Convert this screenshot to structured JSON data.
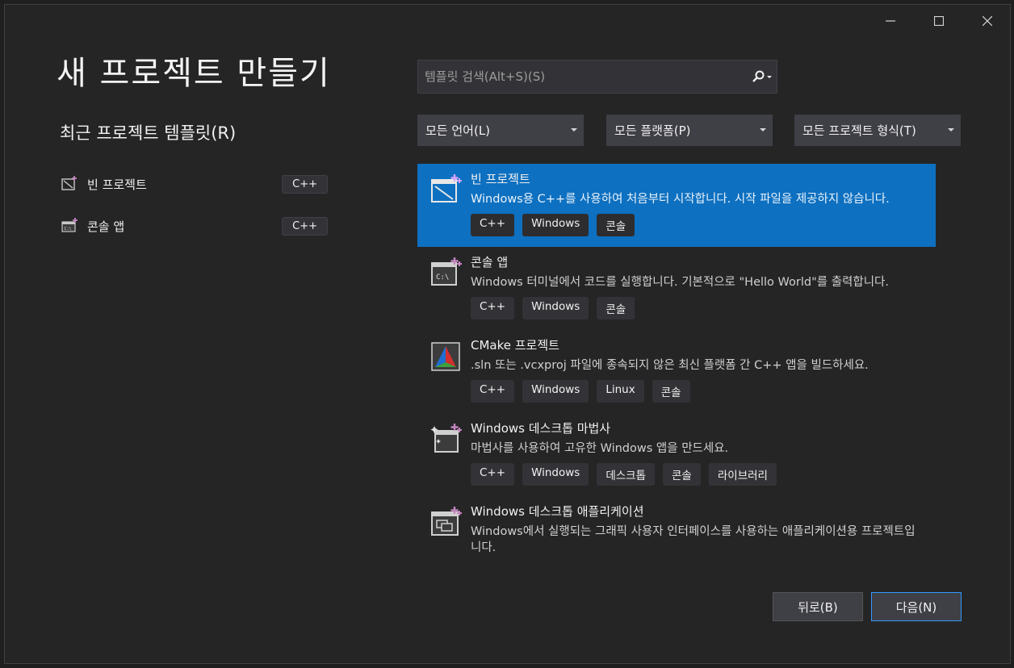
{
  "window_controls": {
    "minimize": "minimize",
    "maximize": "maximize",
    "close": "close"
  },
  "title": "새 프로젝트 만들기",
  "recent": {
    "title": "최근 프로젝트 템플릿(R)",
    "items": [
      {
        "label": "빈 프로젝트",
        "tag": "C++",
        "icon": "empty-project-icon"
      },
      {
        "label": "콘솔 앱",
        "tag": "C++",
        "icon": "console-app-icon"
      }
    ]
  },
  "search": {
    "placeholder": "템플릿 검색(Alt+S)(S)",
    "value": ""
  },
  "filters": [
    {
      "label": "모든 언어(L)"
    },
    {
      "label": "모든 플랫폼(P)"
    },
    {
      "label": "모든 프로젝트 형식(T)"
    }
  ],
  "templates": [
    {
      "name": "빈 프로젝트",
      "description": "Windows용 C++를 사용하여 처음부터 시작합니다. 시작 파일을 제공하지 않습니다.",
      "tags": [
        "C++",
        "Windows",
        "콘솔"
      ],
      "selected": true,
      "icon": "empty-project-icon"
    },
    {
      "name": "콘솔 앱",
      "description": "Windows 터미널에서 코드를 실행합니다. 기본적으로 \"Hello World\"를 출력합니다.",
      "tags": [
        "C++",
        "Windows",
        "콘솔"
      ],
      "selected": false,
      "icon": "console-app-icon"
    },
    {
      "name": "CMake 프로젝트",
      "description": ".sln 또는 .vcxproj 파일에 종속되지 않은 최신 플랫폼 간 C++ 앱을 빌드하세요.",
      "tags": [
        "C++",
        "Windows",
        "Linux",
        "콘솔"
      ],
      "selected": false,
      "icon": "cmake-icon"
    },
    {
      "name": "Windows 데스크톱 마법사",
      "description": "마법사를 사용하여 고유한 Windows 앱을 만드세요.",
      "tags": [
        "C++",
        "Windows",
        "데스크톱",
        "콘솔",
        "라이브러리"
      ],
      "selected": false,
      "icon": "desktop-wizard-icon"
    },
    {
      "name": "Windows 데스크톱 애플리케이션",
      "description": "Windows에서 실행되는 그래픽 사용자 인터페이스를 사용하는 애플리케이션용 프로젝트입니다.",
      "tags": [],
      "selected": false,
      "icon": "desktop-app-icon"
    }
  ],
  "buttons": {
    "back": "뒤로(B)",
    "next": "다음(N)"
  },
  "colors": {
    "selected": "#0e70c0",
    "background": "#252526",
    "accent_border": "#3399ff"
  }
}
